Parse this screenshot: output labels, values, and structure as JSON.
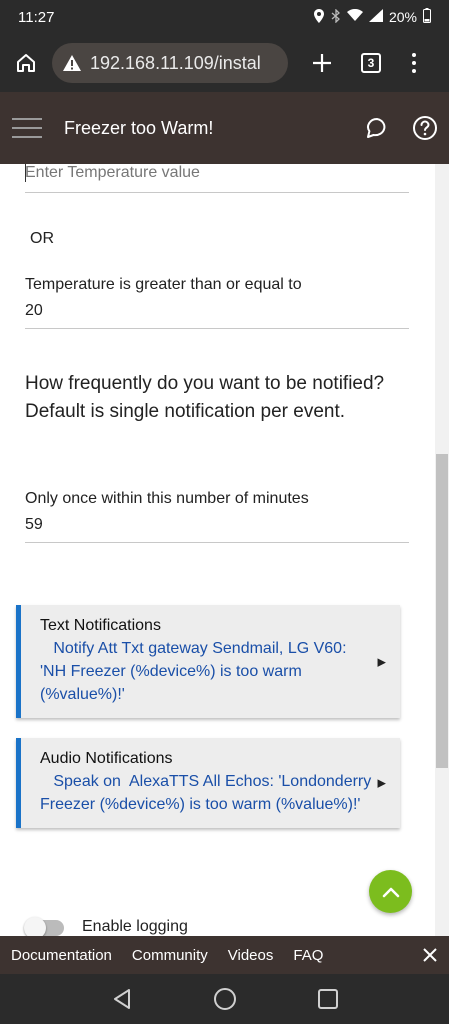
{
  "status": {
    "time": "11:27",
    "battery": "20%"
  },
  "browser": {
    "url": "192.168.11.109/instal",
    "tab_count": "3"
  },
  "app": {
    "title": "Freezer too Warm!"
  },
  "form": {
    "temp_value_placeholder": "Enter Temperature value",
    "or_label": "OR",
    "threshold_label": "Temperature is greater than or equal to",
    "threshold_value": "20",
    "frequency_question": "How frequently do you want to be notified?  Default is single notification per event.",
    "minutes_label": "Only once within this number of minutes",
    "minutes_value": "59"
  },
  "notifications": [
    {
      "title": "Text Notifications",
      "body": "   Notify Att Txt gateway Sendmail, LG V60: 'NH Freezer (%device%) is too warm (%value%)!'"
    },
    {
      "title": "Audio Notifications",
      "body": "   Speak on  AlexaTTS All Echos: 'Londonderry Freezer (%device%) is too warm (%value%)!'"
    }
  ],
  "logging": {
    "label": "Enable logging",
    "enabled": false
  },
  "footer": {
    "links": [
      "Documentation",
      "Community",
      "Videos",
      "FAQ"
    ]
  },
  "colors": {
    "header_bg": "#3d3330",
    "accent_blue": "#1a73c8",
    "fab_green": "#7cbd1e"
  }
}
